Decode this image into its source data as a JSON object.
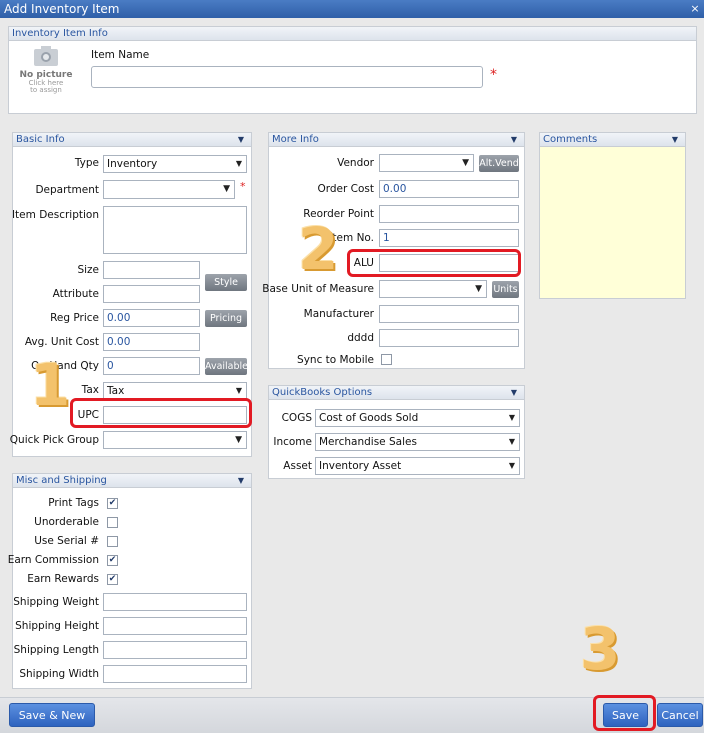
{
  "window": {
    "title": "Add Inventory Item",
    "close": "×"
  },
  "item_info": {
    "title": "Inventory Item Info",
    "item_name_label": "Item Name",
    "item_name_value": "",
    "no_picture": "No picture",
    "click_here": "Click here",
    "to_assign": "to assign"
  },
  "basic_info": {
    "title": "Basic Info",
    "type_label": "Type",
    "type_value": "Inventory",
    "department_label": "Department",
    "department_value": "",
    "description_label": "Item Description",
    "size_label": "Size",
    "attribute_label": "Attribute",
    "style_button": "Style",
    "reg_price_label": "Reg Price",
    "reg_price_value": "0.00",
    "pricing_button": "Pricing",
    "avg_cost_label": "Avg. Unit Cost",
    "avg_cost_value": "0.00",
    "onhand_label": "On Hand Qty",
    "onhand_value": "0",
    "available_button": "Available",
    "tax_label": "Tax",
    "tax_value": "Tax",
    "upc_label": "UPC",
    "upc_value": "",
    "quick_pick_label": "Quick Pick Group",
    "quick_pick_value": ""
  },
  "more_info": {
    "title": "More Info",
    "vendor_label": "Vendor",
    "alt_vend_button": "Alt.Vend",
    "order_cost_label": "Order Cost",
    "order_cost_value": "0.00",
    "reorder_label": "Reorder Point",
    "item_no_label": "Item No.",
    "item_no_value": "1",
    "alu_label": "ALU",
    "alu_value": "",
    "base_unit_label": "Base Unit of Measure",
    "units_button": "Units",
    "manufacturer_label": "Manufacturer",
    "dddd_label": "dddd",
    "sync_label": "Sync to Mobile"
  },
  "comments": {
    "title": "Comments"
  },
  "quickbooks": {
    "title": "QuickBooks Options",
    "cogs_label": "COGS",
    "cogs_value": "Cost of Goods Sold",
    "income_label": "Income",
    "income_value": "Merchandise Sales",
    "asset_label": "Asset",
    "asset_value": "Inventory Asset"
  },
  "misc": {
    "title": "Misc and Shipping",
    "print_tags": "Print Tags",
    "print_tags_checked": true,
    "unorderable": "Unorderable",
    "unorderable_checked": false,
    "use_serial": "Use Serial #",
    "use_serial_checked": false,
    "earn_commission": "Earn Commission",
    "earn_commission_checked": true,
    "earn_rewards": "Earn Rewards",
    "earn_rewards_checked": true,
    "shipping_weight": "Shipping Weight",
    "shipping_height": "Shipping Height",
    "shipping_length": "Shipping Length",
    "shipping_width": "Shipping Width"
  },
  "footer": {
    "save_new": "Save & New",
    "save": "Save",
    "cancel": "Cancel"
  },
  "annotations": {
    "step1": "1",
    "step2": "2",
    "step3": "3"
  },
  "colors": {
    "accent": "#2f5fa8",
    "highlight": "#e21a23",
    "annotation": "#f3c26c",
    "comments_bg": "#ffffd8"
  }
}
